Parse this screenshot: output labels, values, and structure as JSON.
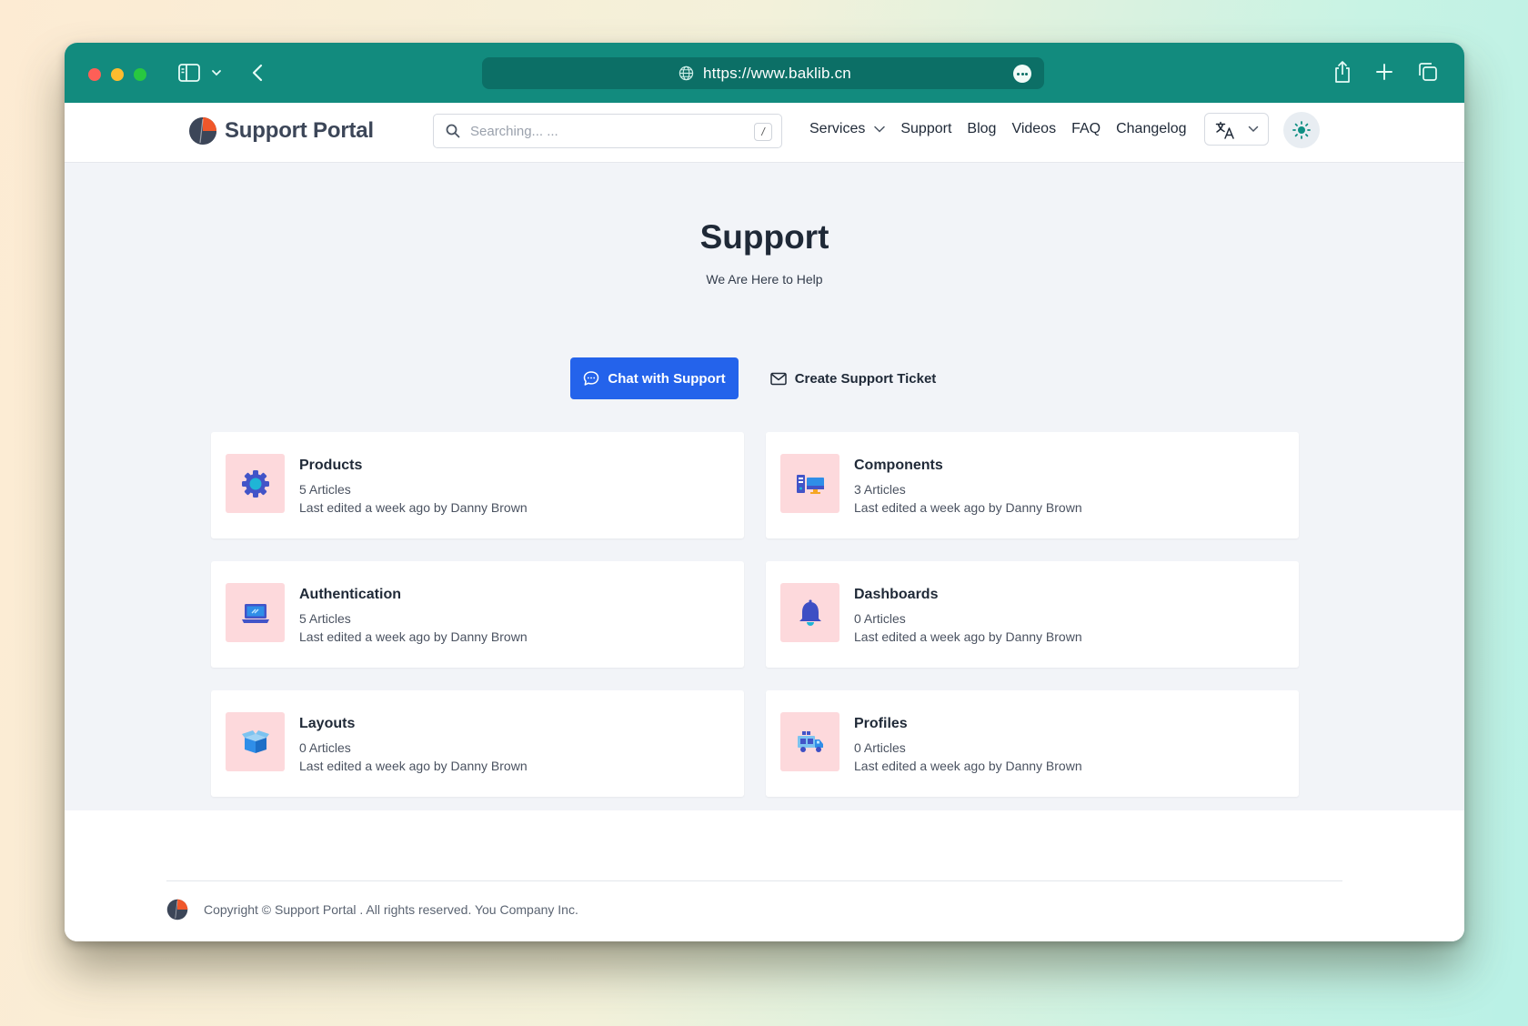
{
  "browser": {
    "url": "https://www.baklib.cn",
    "icons": [
      "sidebar-icon",
      "chevron-down-icon",
      "back-icon",
      "globe-icon",
      "more-icon",
      "share-icon",
      "plus-icon",
      "tabs-icon"
    ]
  },
  "navbar": {
    "brand": "Support Portal",
    "search_placeholder": "Searching... ...",
    "search_shortcut": "/",
    "links": {
      "services": "Services",
      "support": "Support",
      "blog": "Blog",
      "videos": "Videos",
      "faq": "FAQ",
      "changelog": "Changelog"
    }
  },
  "hero": {
    "title": "Support",
    "subtitle": "We Are Here to Help",
    "chat_button": "Chat with Support",
    "ticket_button": "Create Support Ticket"
  },
  "categories": [
    {
      "title": "Products",
      "count": "5 Articles",
      "meta": "Last edited a week ago by Danny Brown",
      "icon": "gear-icon"
    },
    {
      "title": "Components",
      "count": "3 Articles",
      "meta": "Last edited a week ago by Danny Brown",
      "icon": "computer-icon"
    },
    {
      "title": "Authentication",
      "count": "5 Articles",
      "meta": "Last edited a week ago by Danny Brown",
      "icon": "laptop-icon"
    },
    {
      "title": "Dashboards",
      "count": "0 Articles",
      "meta": "Last edited a week ago by Danny Brown",
      "icon": "bell-icon"
    },
    {
      "title": "Layouts",
      "count": "0 Articles",
      "meta": "Last edited a week ago by Danny Brown",
      "icon": "box-icon"
    },
    {
      "title": "Profiles",
      "count": "0 Articles",
      "meta": "Last edited a week ago by Danny Brown",
      "icon": "truck-icon"
    }
  ],
  "footer": {
    "copyright": "Copyright © Support Portal . All rights reserved. You Company Inc."
  },
  "colors": {
    "chrome": "#128b7e",
    "primary": "#2463eb",
    "card_icon_bg": "#fdd9dc",
    "page_bg": "#f2f4f8"
  }
}
